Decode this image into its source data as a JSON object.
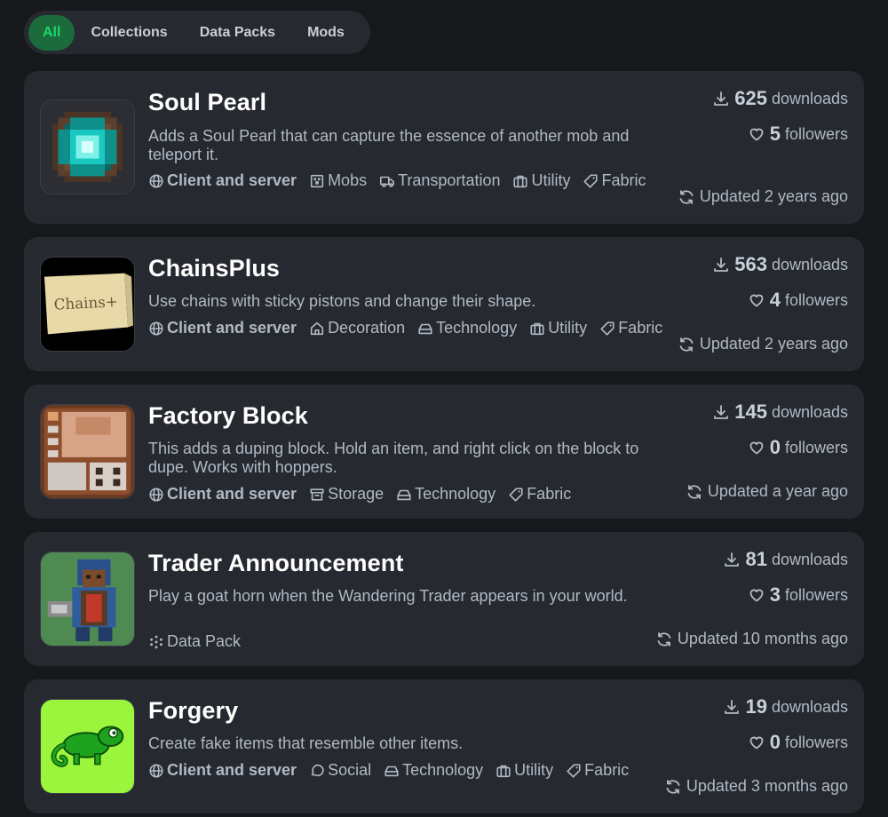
{
  "tabs": [
    {
      "label": "All",
      "active": true
    },
    {
      "label": "Collections",
      "active": false
    },
    {
      "label": "Data Packs",
      "active": false
    },
    {
      "label": "Mods",
      "active": false
    }
  ],
  "projects": [
    {
      "title": "Soul Pearl",
      "icon": "soul-pearl-icon",
      "description": "Adds a Soul Pearl that can capture the essence of another mob and teleport it.",
      "environment": "Client and server",
      "categories": [
        {
          "label": "Mobs",
          "icon": "mobs-icon"
        },
        {
          "label": "Transportation",
          "icon": "truck-icon"
        },
        {
          "label": "Utility",
          "icon": "briefcase-icon"
        },
        {
          "label": "Fabric",
          "icon": "tag-icon"
        }
      ],
      "downloads": "625",
      "downloads_label": "downloads",
      "followers": "5",
      "followers_label": "followers",
      "updated": "Updated 2 years ago"
    },
    {
      "title": "ChainsPlus",
      "icon": "chainsplus-icon",
      "icon_text": "Chains+",
      "description": "Use chains with sticky pistons and change their shape.",
      "environment": "Client and server",
      "categories": [
        {
          "label": "Decoration",
          "icon": "house-icon"
        },
        {
          "label": "Technology",
          "icon": "hard-drive-icon"
        },
        {
          "label": "Utility",
          "icon": "briefcase-icon"
        },
        {
          "label": "Fabric",
          "icon": "tag-icon"
        }
      ],
      "downloads": "563",
      "downloads_label": "downloads",
      "followers": "4",
      "followers_label": "followers",
      "updated": "Updated 2 years ago"
    },
    {
      "title": "Factory Block",
      "icon": "factory-block-icon",
      "description": "This adds a duping block. Hold an item, and right click on the block to dupe. Works with hoppers.",
      "environment": "Client and server",
      "categories": [
        {
          "label": "Storage",
          "icon": "archive-icon"
        },
        {
          "label": "Technology",
          "icon": "hard-drive-icon"
        },
        {
          "label": "Fabric",
          "icon": "tag-icon"
        }
      ],
      "downloads": "145",
      "downloads_label": "downloads",
      "followers": "0",
      "followers_label": "followers",
      "updated": "Updated a year ago"
    },
    {
      "title": "Trader Announcement",
      "icon": "trader-icon",
      "description": "Play a goat horn when the Wandering Trader appears in your world.",
      "environment": "",
      "categories": [
        {
          "label": "Data Pack",
          "icon": "datapack-icon"
        }
      ],
      "downloads": "81",
      "downloads_label": "downloads",
      "followers": "3",
      "followers_label": "followers",
      "updated": "Updated 10 months ago"
    },
    {
      "title": "Forgery",
      "icon": "forgery-icon",
      "description": "Create fake items that resemble other items.",
      "environment": "Client and server",
      "categories": [
        {
          "label": "Social",
          "icon": "chat-icon"
        },
        {
          "label": "Technology",
          "icon": "hard-drive-icon"
        },
        {
          "label": "Utility",
          "icon": "briefcase-icon"
        },
        {
          "label": "Fabric",
          "icon": "tag-icon"
        }
      ],
      "downloads": "19",
      "downloads_label": "downloads",
      "followers": "0",
      "followers_label": "followers",
      "updated": "Updated 3 months ago"
    }
  ],
  "colors": {
    "background": "#16181c",
    "card": "#26292f",
    "accent": "#1bd96a",
    "accent_bg": "#1b6b3c",
    "text": "#b0bac5",
    "title": "#ffffff"
  }
}
